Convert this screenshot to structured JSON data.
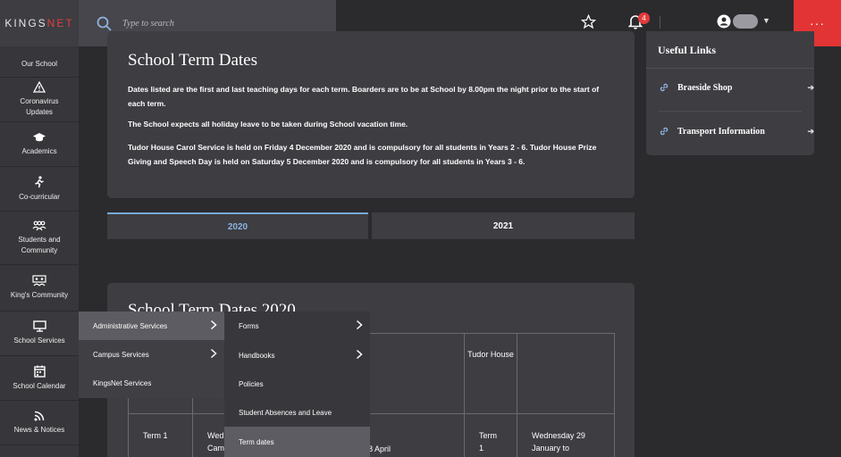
{
  "brand": {
    "logo_a": "KINGS",
    "logo_b": "NET"
  },
  "search": {
    "placeholder": "Type to search"
  },
  "topbar": {
    "notifications_count": "4",
    "more_label": "···"
  },
  "sidebar": {
    "items": [
      {
        "label": "Our School"
      },
      {
        "label": "Coronavirus\nUpdates"
      },
      {
        "label": "Academics"
      },
      {
        "label": "Co-curricular"
      },
      {
        "label": "Students and\nCommunity"
      },
      {
        "label": "King's Community"
      },
      {
        "label": "School Services"
      },
      {
        "label": "School Calendar"
      },
      {
        "label": "News & Notices"
      }
    ]
  },
  "intro": {
    "title": "School Term Dates",
    "p1": "Dates listed are the first and last teaching days for each term. Boarders are to be at School by 8.00pm the night prior to the start of each term.",
    "p2": "The School expects all holiday leave to be taken during School vacation time.",
    "p3": "Tudor House Carol Service is held on Friday 4 December 2020 and is compulsory for all students in Years 2 - 6. Tudor House Prize Giving and Speech Day is held on Saturday 5 December 2020 and is compulsory for all students in Years 3 - 6."
  },
  "tabs": {
    "tab_2020": "2020",
    "tab_2021": "2021"
  },
  "useful_links": {
    "title": "Useful Links",
    "items": [
      {
        "label": "Braeside Shop"
      },
      {
        "label": "Transport Information"
      }
    ]
  },
  "term_table": {
    "title": "School Term Dates 2020",
    "header_tudor": "Tudor House",
    "row1_term": "Term 1",
    "row1_partial_a": "Wed",
    "row1_partial_b": "Cam",
    "row1_april": "8 April",
    "row1_tudor_term": "Term 1",
    "row1_date": "Wednesday 29 January to"
  },
  "menu_level1": {
    "items": [
      {
        "label": "Administrative Services"
      },
      {
        "label": "Campus Services"
      },
      {
        "label": "KingsNet Services"
      }
    ]
  },
  "menu_level2": {
    "items": [
      {
        "label": "Forms"
      },
      {
        "label": "Handbooks"
      },
      {
        "label": "Policies"
      },
      {
        "label": "Student Absences and Leave"
      },
      {
        "label": "Term dates"
      }
    ]
  },
  "colors": {
    "accent": "#e23434",
    "tab_active": "#7aa6d6"
  }
}
